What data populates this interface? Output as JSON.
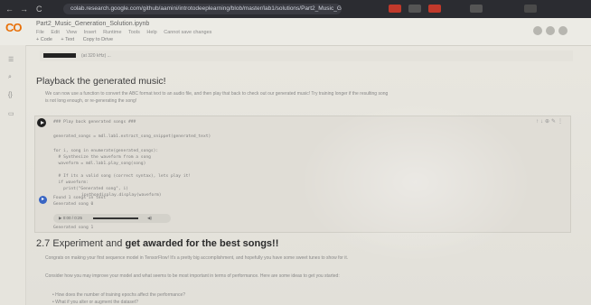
{
  "browser": {
    "url": "colab.research.google.com/github/aamini/introtodeeplearning/blob/master/lab1/solutions/Part2_Music_Generation_Solution.ipynb",
    "back_glyph": "←",
    "forward_glyph": "→",
    "reload_glyph": "C"
  },
  "colab": {
    "logo_text": "CO",
    "notebook_title": "Part2_Music_Generation_Solution.ipynb",
    "menu": [
      "File",
      "Edit",
      "View",
      "Insert",
      "Runtime",
      "Tools",
      "Help",
      "Cannot save changes"
    ],
    "toolbar": [
      "+ Code",
      "+ Text",
      "Copy to Drive"
    ]
  },
  "content": {
    "top_cell_text": "(at 320 kHz) ...",
    "section1_heading": "Playback the generated music!",
    "section1_text": "We can now use a function to convert the ABC format text to an audio file, and then play that back to check out our generated music! Try training longer if the resulting song is not long enough, or re-generating the song!",
    "code_lines": [
      "### Play back generated songs ###",
      "",
      "generated_songs = mdl.lab1.extract_song_snippet(generated_text)",
      "",
      "for i, song in enumerate(generated_songs):",
      "  # Synthesize the waveform from a song",
      "  waveform = mdl.lab1.play_song(song)",
      "",
      "  # If its a valid song (correct syntax), lets play it!",
      "  if waveform:",
      "    print(\"Generated song\", i)",
      "    ipythondisplay.display(waveform)"
    ],
    "output_lines": [
      "Found 1 songs in text",
      "Generated song 0"
    ],
    "audio_time": "0:00 / 0:25",
    "output_tail": "Generated song 1",
    "section2_number": "2.7",
    "section2_heading_plain": "Experiment and",
    "section2_heading_bold": "get awarded for the best songs!!",
    "section2_text1": "Congrats on making your first sequence model in TensorFlow! It's a pretty big accomplishment, and hopefully you have some sweet tunes to show for it.",
    "section2_text2": "Consider how you may improve your model and what seems to be most important in terms of performance. Here are some ideas to get you started:",
    "bullets": [
      "How does the number of training epochs affect the performance?",
      "What if you alter or augment the dataset?"
    ]
  }
}
